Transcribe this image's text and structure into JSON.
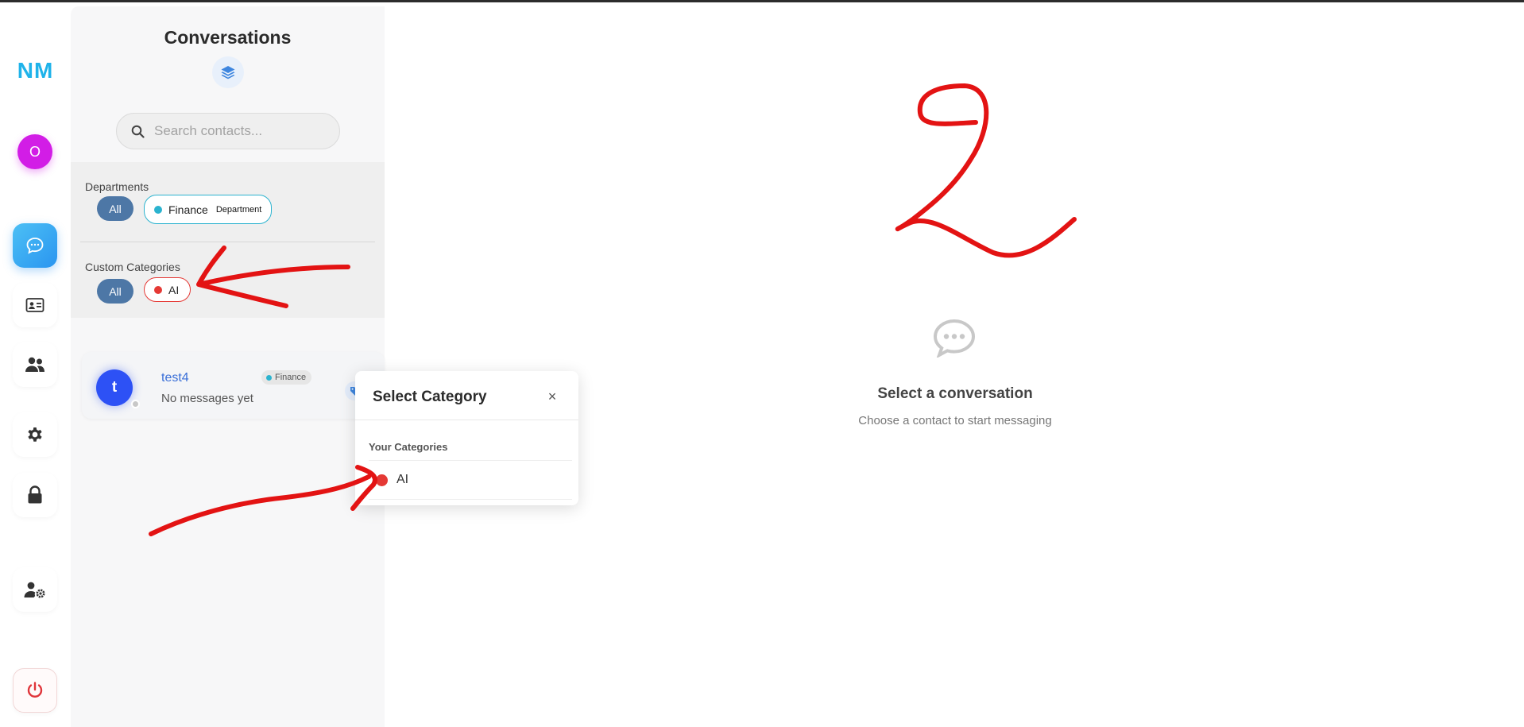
{
  "app": {
    "logo": "NM",
    "user_initial": "O"
  },
  "nav": {
    "items": [
      {
        "icon": "chat-bubble-icon",
        "active": true
      },
      {
        "icon": "id-card-icon",
        "active": false
      },
      {
        "icon": "users-icon",
        "active": false
      },
      {
        "icon": "gear-icon",
        "active": false
      },
      {
        "icon": "lock-icon",
        "active": false
      },
      {
        "icon": "user-settings-icon",
        "active": false
      },
      {
        "icon": "power-icon",
        "active": false
      }
    ]
  },
  "conversations": {
    "title": "Conversations",
    "search_placeholder": "Search contacts...",
    "departments": {
      "label": "Departments",
      "all_label": "All",
      "chip": {
        "name": "Finance",
        "tag": "Department",
        "color": "#2bb3cf"
      }
    },
    "custom_categories": {
      "label": "Custom Categories",
      "all_label": "All",
      "chip": {
        "name": "AI",
        "color": "#e53935"
      }
    },
    "items": [
      {
        "initial": "t",
        "name": "test4",
        "preview": "No messages yet",
        "badge": "Finance",
        "badge_color": "#2bb3cf"
      }
    ]
  },
  "popup": {
    "title": "Select Category",
    "close": "×",
    "section": "Your Categories",
    "items": [
      {
        "name": "AI",
        "color": "#e53935"
      }
    ]
  },
  "empty_state": {
    "title": "Select a conversation",
    "subtitle": "Choose a contact to start messaging"
  },
  "colors": {
    "accent": "#2a95f0",
    "chip_all": "#4d77a6",
    "annotation": "#e00000"
  }
}
